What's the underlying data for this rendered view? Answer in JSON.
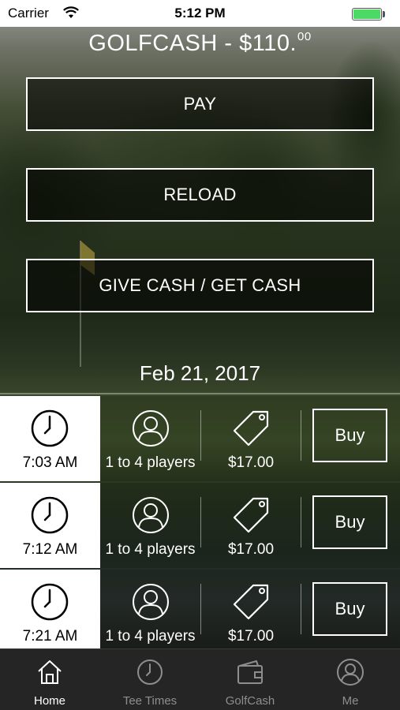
{
  "status_bar": {
    "carrier": "Carrier",
    "time": "5:12 PM",
    "battery_color": "#4cd964"
  },
  "header": {
    "title": "GOLFCASH - $110.",
    "cents": "00"
  },
  "actions": {
    "pay_label": "PAY",
    "reload_label": "RELOAD",
    "give_get_label": "GIVE CASH / GET CASH"
  },
  "date": "Feb 21, 2017",
  "tee_times": [
    {
      "time": "7:03 AM",
      "players": "1 to 4 players",
      "price": "$17.00",
      "buy_label": "Buy"
    },
    {
      "time": "7:12 AM",
      "players": "1 to 4 players",
      "price": "$17.00",
      "buy_label": "Buy"
    },
    {
      "time": "7:21 AM",
      "players": "1 to 4 players",
      "price": "$17.00",
      "buy_label": "Buy"
    }
  ],
  "tab_bar": {
    "items": [
      {
        "label": "Home",
        "icon": "home-icon",
        "active": true
      },
      {
        "label": "Tee Times",
        "icon": "clock-icon",
        "active": false
      },
      {
        "label": "GolfCash",
        "icon": "wallet-icon",
        "active": false
      },
      {
        "label": "Me",
        "icon": "user-icon",
        "active": false
      }
    ]
  },
  "colors": {
    "tab_active": "#ffffff",
    "tab_inactive": "#8e8e8e",
    "tab_bar_bg": "#252525"
  }
}
